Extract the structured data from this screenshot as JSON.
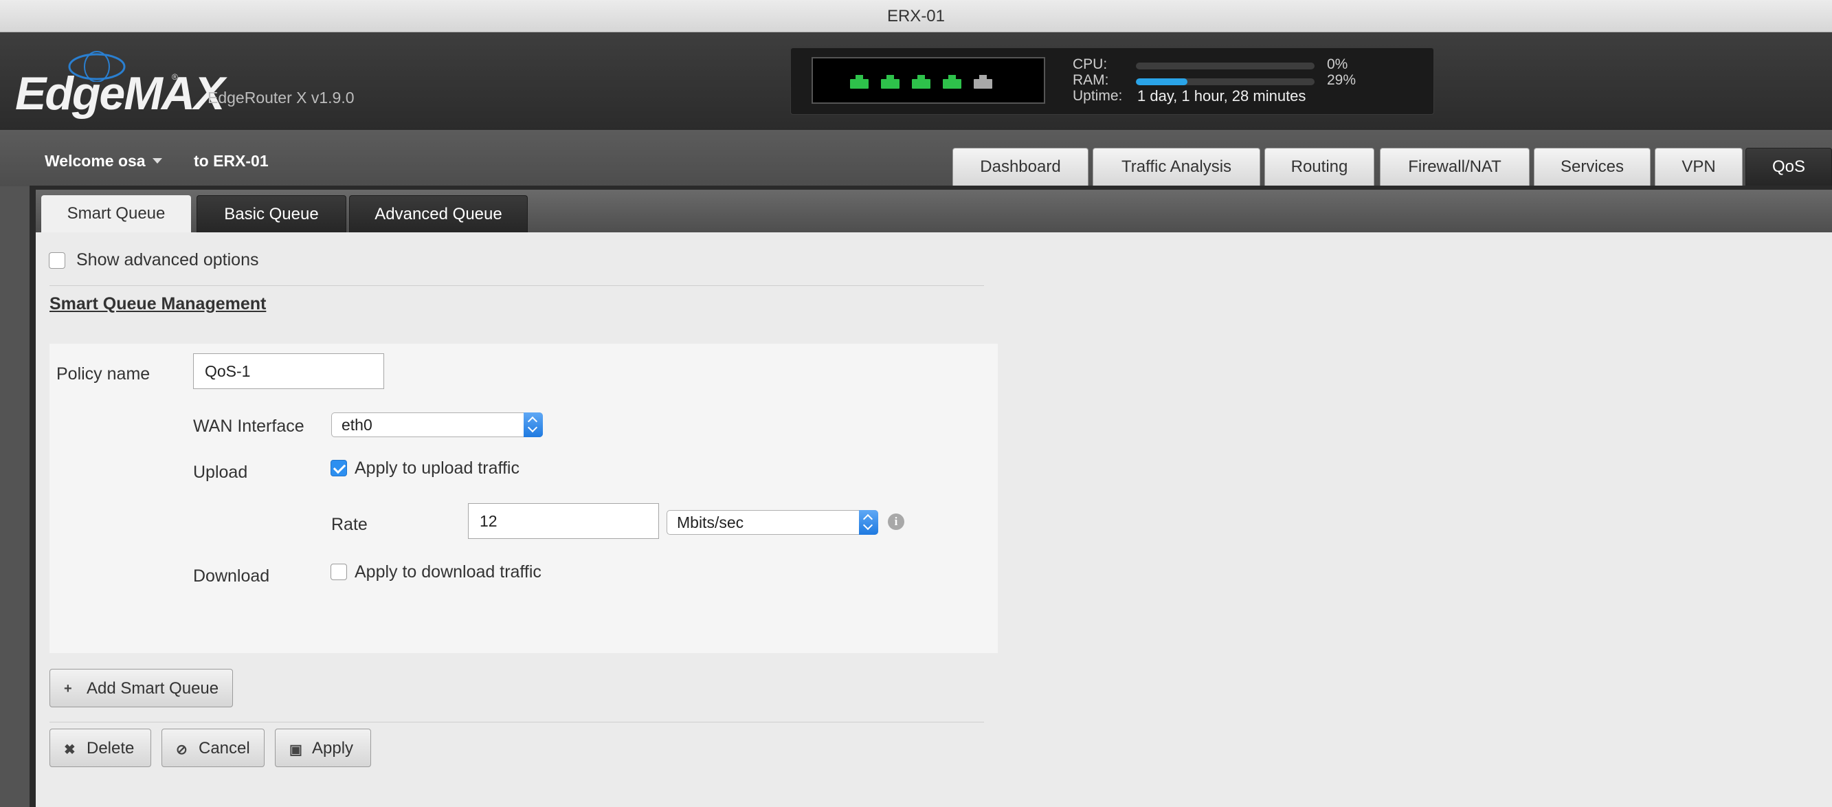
{
  "window": {
    "title": "ERX-01"
  },
  "header": {
    "logo_text": "EdgeMAX",
    "product": "EdgeRouter X v1.9.0",
    "ports": [
      {
        "status": "up",
        "color": "#2ec24b"
      },
      {
        "status": "up",
        "color": "#2ec24b"
      },
      {
        "status": "up",
        "color": "#2ec24b"
      },
      {
        "status": "up",
        "color": "#2ec24b"
      },
      {
        "status": "down",
        "color": "#a9a9a9"
      }
    ],
    "cpu": {
      "label": "CPU:",
      "value": "0%",
      "fraction": 0.0
    },
    "ram": {
      "label": "RAM:",
      "value": "29%",
      "fraction": 0.29
    },
    "uptime": {
      "label": "Uptime:",
      "value": "1 day, 1 hour, 28 minutes"
    }
  },
  "subheader": {
    "welcome": "Welcome osa",
    "to_host": "to ERX-01"
  },
  "nav": {
    "tabs": [
      {
        "label": "Dashboard",
        "active": false
      },
      {
        "label": "Traffic Analysis",
        "active": false
      },
      {
        "label": "Routing",
        "active": false
      },
      {
        "label": "Firewall/NAT",
        "active": false
      },
      {
        "label": "Services",
        "active": false
      },
      {
        "label": "VPN",
        "active": false
      },
      {
        "label": "QoS",
        "active": true
      }
    ]
  },
  "subtabs": [
    {
      "label": "Smart Queue",
      "active": true
    },
    {
      "label": "Basic Queue",
      "active": false
    },
    {
      "label": "Advanced Queue",
      "active": false
    }
  ],
  "form": {
    "show_advanced": {
      "label": "Show advanced options",
      "checked": false
    },
    "section_title": "Smart Queue Management",
    "policy_name": {
      "label": "Policy name",
      "value": "QoS-1"
    },
    "wan_interface": {
      "label": "WAN Interface",
      "value": "eth0"
    },
    "upload": {
      "label": "Upload",
      "checkbox_label": "Apply to upload traffic",
      "checked": true
    },
    "rate": {
      "label": "Rate",
      "value": "12",
      "unit": "Mbits/sec"
    },
    "download": {
      "label": "Download",
      "checkbox_label": "Apply to download traffic",
      "checked": false
    },
    "info_icon": "info-icon"
  },
  "buttons": {
    "add": "Add Smart Queue",
    "delete": "Delete",
    "cancel": "Cancel",
    "apply": "Apply"
  },
  "colors": {
    "accent": "#2d8ff0",
    "port_up": "#2ec24b",
    "port_down": "#a9a9a9",
    "ram_bar": "#2aa4e8"
  }
}
